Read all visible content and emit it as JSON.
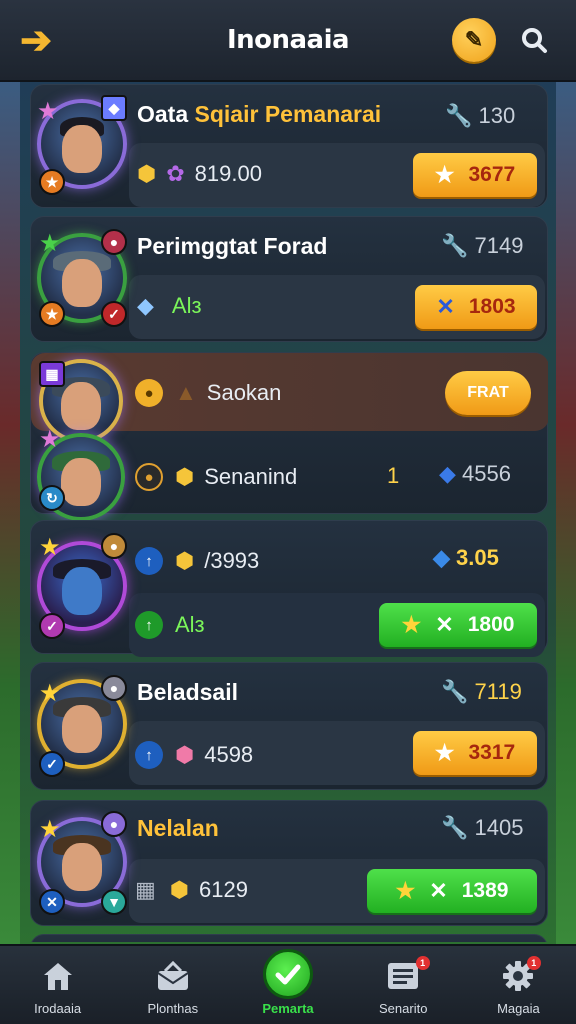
{
  "header": {
    "title": "Inonaaia",
    "back_icon": "arrow-left-icon",
    "edit_icon": "pencil-icon",
    "search_icon": "search-icon"
  },
  "cards": [
    {
      "name_a": "Oata ",
      "name_b": "Sqiair Pemanarai",
      "right_stat": "130",
      "row_value": "819.00",
      "button_label": "3677"
    },
    {
      "name": "Perimggtat Forad",
      "right_stat": "7149",
      "row_value": "Alз",
      "button_label": "1803"
    },
    {
      "row1_value": "Saokan",
      "row1_button": "FRAT",
      "row2_value": "Senanind",
      "row2_mid": "1",
      "row2_stat": "4556"
    },
    {
      "row1_value": "/3993",
      "row1_stat": "3.05",
      "row2_value": "Alз",
      "row2_button": "1800"
    },
    {
      "name": "Beladsail",
      "right_stat": "7119",
      "row_value": "4598",
      "button_label": "3317"
    },
    {
      "name": "Nelalan",
      "right_stat": "1405",
      "row_value": "6129",
      "button_label": "1389"
    }
  ],
  "nav": [
    {
      "label": "Irodaaia",
      "icon": "home-icon"
    },
    {
      "label": "Plonthas",
      "icon": "inbox-icon"
    },
    {
      "label": "Pemarta",
      "icon": "check-icon",
      "active": true
    },
    {
      "label": "Senarito",
      "icon": "list-icon",
      "badge": "1"
    },
    {
      "label": "Magaia",
      "icon": "gear-icon",
      "badge": "1"
    }
  ],
  "colors": {
    "accent_gold": "#ffc23a",
    "button_orange": "#f0a21a",
    "button_green": "#22b022",
    "active_nav": "#39e04a"
  }
}
